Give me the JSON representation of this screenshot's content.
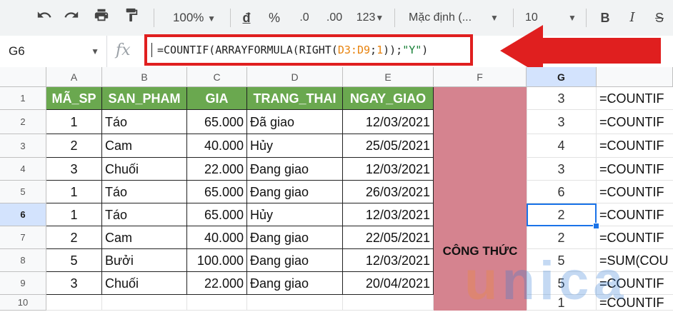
{
  "toolbar": {
    "zoom": "100%",
    "currency": "đ",
    "percent": "%",
    "dec_decrease": ".0",
    "dec_increase": ".00",
    "more_formats": "123",
    "font_name": "Mặc định (...",
    "font_size": "10"
  },
  "formula_bar": {
    "cell_ref": "G6",
    "fx": "fx",
    "formula_parts": [
      "=COUNTIF(ARRAYFORMULA(RIGHT(",
      "D3:D9",
      ";",
      "1",
      "));",
      "\"Y\"",
      ")"
    ]
  },
  "columns": [
    "A",
    "B",
    "C",
    "D",
    "E",
    "F",
    "G"
  ],
  "rows": [
    "1",
    "2",
    "3",
    "4",
    "5",
    "6",
    "7",
    "8",
    "9",
    "10"
  ],
  "table_header": [
    "MÃ_SP",
    "SAN_PHAM",
    "GIA",
    "TRANG_THAI",
    "NGAY_GIAO"
  ],
  "table_rows": [
    [
      "1",
      "Táo",
      "65.000",
      "Đã giao",
      "12/03/2021"
    ],
    [
      "2",
      "Cam",
      "40.000",
      "Hủy",
      "25/05/2021"
    ],
    [
      "3",
      "Chuối",
      "22.000",
      "Đang giao",
      "12/03/2021"
    ],
    [
      "1",
      "Táo",
      "65.000",
      "Đang giao",
      "26/03/2021"
    ],
    [
      "1",
      "Táo",
      "65.000",
      "Hủy",
      "12/03/2021"
    ],
    [
      "2",
      "Cam",
      "40.000",
      "Đang giao",
      "22/05/2021"
    ],
    [
      "5",
      "Bưởi",
      "100.000",
      "Đang giao",
      "12/03/2021"
    ],
    [
      "3",
      "Chuối",
      "22.000",
      "Đang giao",
      "20/04/2021"
    ]
  ],
  "f_label": "CÔNG THỨC",
  "g_values": [
    "3",
    "3",
    "4",
    "3",
    "6",
    "2",
    "2",
    "5",
    "5",
    "1"
  ],
  "h_values": [
    "=COUNTIF",
    "=COUNTIF",
    "=COUNTIF",
    "=COUNTIF",
    "=COUNTIF",
    "=COUNTIF",
    "=COUNTIF",
    "=SUM(COU",
    "=COUNTIF",
    "=COUNTIF"
  ],
  "watermark": "unica",
  "colors": {
    "header_green": "#6aa84f",
    "formula_column": "#d5838f",
    "highlight_red": "#e01f1f",
    "selection_blue": "#1a73e8"
  }
}
